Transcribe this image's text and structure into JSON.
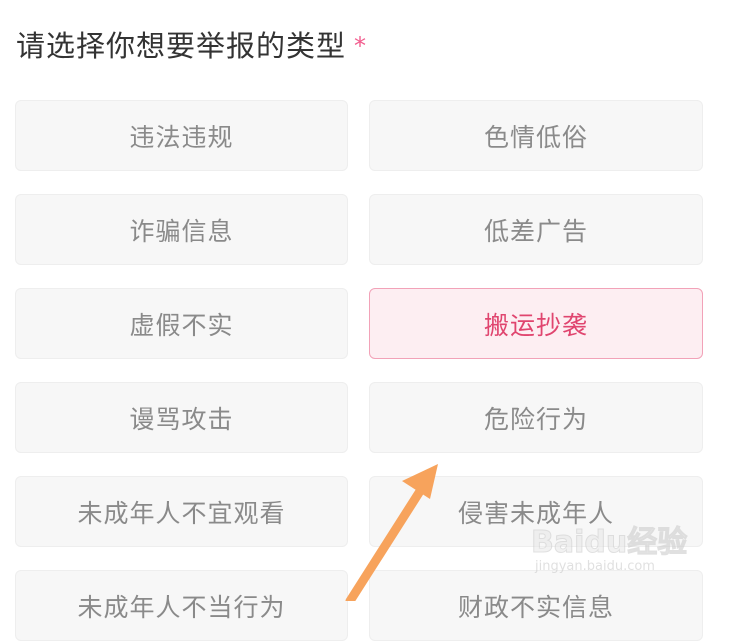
{
  "form": {
    "title": "请选择你想要举报的类型",
    "required_mark": "*",
    "options": [
      {
        "label": "违法违规",
        "selected": false
      },
      {
        "label": "色情低俗",
        "selected": false
      },
      {
        "label": "诈骗信息",
        "selected": false
      },
      {
        "label": "低差广告",
        "selected": false
      },
      {
        "label": "虚假不实",
        "selected": false
      },
      {
        "label": "搬运抄袭",
        "selected": true
      },
      {
        "label": "谩骂攻击",
        "selected": false
      },
      {
        "label": "危险行为",
        "selected": false
      },
      {
        "label": "未成年人不宜观看",
        "selected": false
      },
      {
        "label": "侵害未成年人",
        "selected": false
      },
      {
        "label": "未成年人不当行为",
        "selected": false
      },
      {
        "label": "财政不实信息",
        "selected": false
      }
    ]
  },
  "watermark": {
    "logo": "Baidu经验",
    "url": "jingyan.baidu.com"
  },
  "colors": {
    "accent": "#e0456f",
    "selected_bg": "#fdeef2",
    "option_bg": "#f7f7f7",
    "arrow": "#f7a35c"
  }
}
